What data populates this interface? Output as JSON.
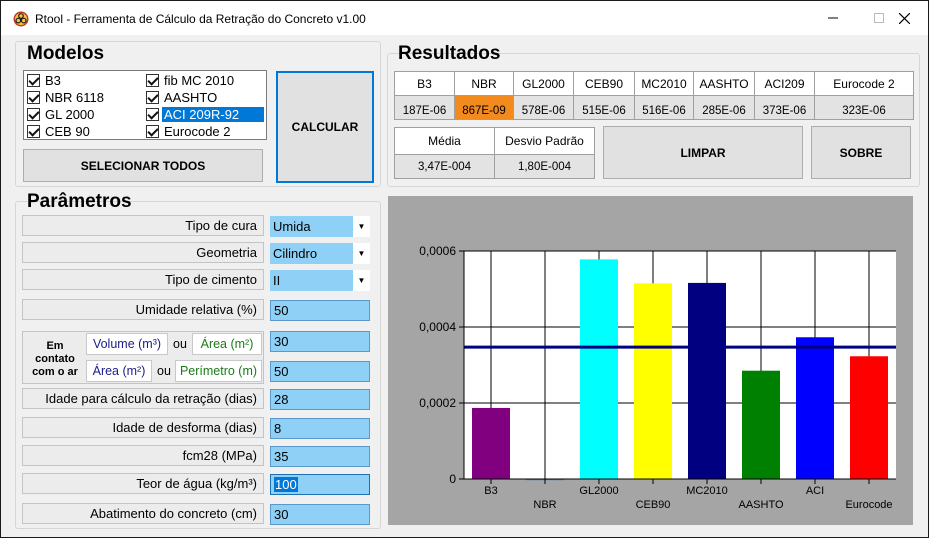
{
  "window": {
    "title": "Rtool - Ferramenta de Cálculo da Retração do Concreto v1.00",
    "icon": "biohazard-icon",
    "controls": [
      "minimize-icon",
      "maximize-icon",
      "close-icon"
    ]
  },
  "modelos": {
    "title": "Modelos",
    "items": [
      {
        "label": "B3",
        "checked": true
      },
      {
        "label": "NBR 6118",
        "checked": true
      },
      {
        "label": "GL 2000",
        "checked": true
      },
      {
        "label": "CEB 90",
        "checked": true
      },
      {
        "label": "fib MC 2010",
        "checked": true
      },
      {
        "label": "AASHTO",
        "checked": true
      },
      {
        "label": "ACI 209R-92",
        "checked": true,
        "selected": true
      },
      {
        "label": "Eurocode 2",
        "checked": true
      }
    ],
    "select_all_label": "SELECIONAR TODOS",
    "calc_label": "CALCULAR"
  },
  "resultados": {
    "title": "Resultados",
    "headers": [
      "B3",
      "NBR",
      "GL2000",
      "CEB90",
      "MC2010",
      "AASHTO",
      "ACI209",
      "Eurocode 2"
    ],
    "values": [
      "187E-06",
      "867E-09",
      "578E-06",
      "515E-06",
      "516E-06",
      "285E-06",
      "373E-06",
      "323E-06"
    ],
    "highlight_color": "#f28a1e",
    "stats_headers": [
      "Média",
      "Desvio Padrão"
    ],
    "stats_values": [
      "3,47E-004",
      "1,80E-004"
    ],
    "clear_label": "LIMPAR",
    "about_label": "SOBRE"
  },
  "parametros": {
    "title": "Parâmetros",
    "tipo_cura": {
      "label": "Tipo de cura",
      "value": "Umida"
    },
    "geometria": {
      "label": "Geometria",
      "value": "Cilindro"
    },
    "tipo_cimento": {
      "label": "Tipo de cimento",
      "value": "II"
    },
    "umidade": {
      "label": "Umidade relativa (%)",
      "value": "50"
    },
    "contato": {
      "label": "Em contato com o ar",
      "volume_label": "Volume (m³)",
      "ou1": "ou",
      "area_label1": "Área (m²)",
      "area_label2": "Área (m²)",
      "ou2": "ou",
      "perimetro_label": "Perímetro (m)",
      "value1": "30",
      "value2": "50"
    },
    "idade_retracao": {
      "label": "Idade para cálculo da retração (dias)",
      "value": "28"
    },
    "idade_desforma": {
      "label": "Idade de desforma (dias)",
      "value": "8"
    },
    "fcm28": {
      "label": "fcm28 (MPa)",
      "value": "35"
    },
    "teor_agua": {
      "label": "Teor de água (kg/m³)",
      "value": "100"
    },
    "abatimento": {
      "label": "Abatimento do concreto (cm)",
      "value": "30"
    }
  },
  "chart_data": {
    "type": "bar",
    "categories": [
      "B3",
      "NBR",
      "GL2000",
      "CEB90",
      "MC2010",
      "AASHTO",
      "ACI",
      "Eurocode"
    ],
    "values": [
      0.000187,
      8.67e-07,
      0.000578,
      0.000515,
      0.000516,
      0.000285,
      0.000373,
      0.000323
    ],
    "colors": [
      "#800080",
      "#4682b4",
      "#00ffff",
      "#ffff00",
      "#000080",
      "#008000",
      "#0000ff",
      "#ff0000"
    ],
    "mean_line": 0.000347,
    "mean_line_color": "#000080",
    "ylim": [
      0,
      0.0006
    ],
    "yticks": [
      0,
      0.0002,
      0.0004,
      0.0006
    ],
    "ytick_labels": [
      "0",
      "0,0002",
      "0,0004",
      "0,0006"
    ],
    "grid": true
  }
}
